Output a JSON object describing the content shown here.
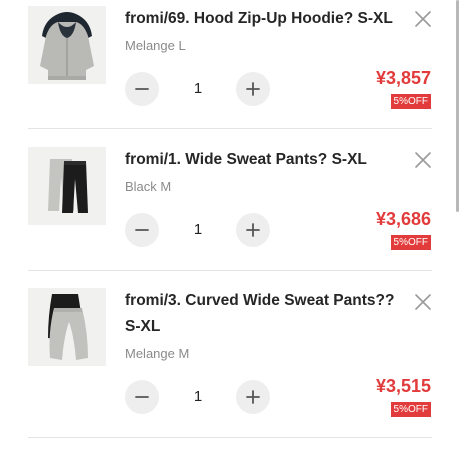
{
  "cart": {
    "items": [
      {
        "title": "fromi/69. Hood Zip-Up Hoodie? S-XL",
        "variant": "Melange L",
        "quantity": "1",
        "price": "¥3,857",
        "discount": "5%OFF"
      },
      {
        "title": "fromi/1. Wide Sweat Pants? S-XL",
        "variant": "Black M",
        "quantity": "1",
        "price": "¥3,686",
        "discount": "5%OFF"
      },
      {
        "title": "fromi/3. Curved Wide Sweat Pants?? S-XL",
        "variant": "Melange M",
        "quantity": "1",
        "price": "¥3,515",
        "discount": "5%OFF"
      }
    ]
  },
  "colors": {
    "price": "#e23b3b",
    "discount_badge": "#e23b3b",
    "stepper_bg": "#eeeeee",
    "divider": "#e4e4e4"
  },
  "icons": {
    "remove": "close-icon",
    "decrement": "minus-icon",
    "increment": "plus-icon"
  }
}
